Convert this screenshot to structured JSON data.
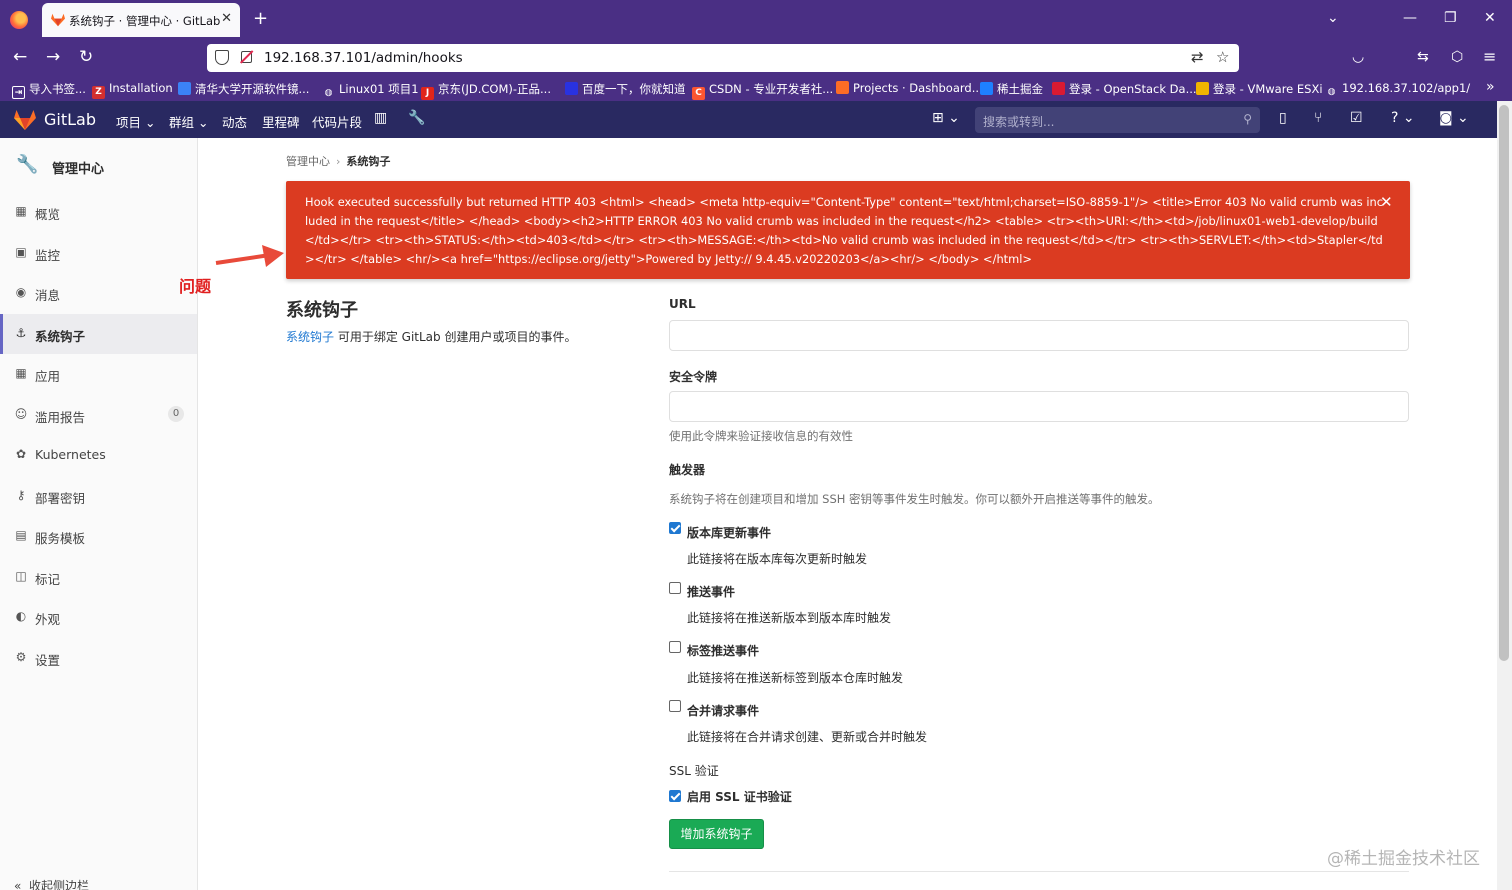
{
  "browser": {
    "tab_title": "系统钩子 · 管理中心 · GitLab",
    "url": "192.168.37.101/admin/hooks",
    "bookmarks": [
      {
        "label": "导入书签...",
        "color": "#4a2f84"
      },
      {
        "label": "Installation",
        "color": "#d32f2f"
      },
      {
        "label": "清华大学开源软件镜...",
        "color": "#3b82f6"
      },
      {
        "label": "Linux01 项目1",
        "color": "#4a2f84"
      },
      {
        "label": "京东(JD.COM)-正品...",
        "color": "#e1251b"
      },
      {
        "label": "百度一下，你就知道",
        "color": "#2932e1"
      },
      {
        "label": "CSDN - 专业开发者社...",
        "color": "#fc5531"
      },
      {
        "label": "Projects · Dashboard...",
        "color": "#fc6d26"
      },
      {
        "label": "稀土掘金",
        "color": "#1e80ff"
      },
      {
        "label": "登录 - OpenStack Da...",
        "color": "#da1a32"
      },
      {
        "label": "登录 - VMware ESXi",
        "color": "#f0b400"
      },
      {
        "label": "192.168.37.102/app1/",
        "color": "#4a2f84"
      }
    ]
  },
  "gitlab": {
    "brand": "GitLab",
    "nav": [
      "项目",
      "群组",
      "动态",
      "里程碑",
      "代码片段"
    ],
    "search_placeholder": "搜索或转到..."
  },
  "sidebar": {
    "title": "管理中心",
    "items": [
      {
        "label": "概览",
        "icon": "overview-icon",
        "glyph": "▦"
      },
      {
        "label": "监控",
        "icon": "monitor-icon",
        "glyph": "▣"
      },
      {
        "label": "消息",
        "icon": "broadcast-icon",
        "glyph": "◉"
      },
      {
        "label": "系统钩子",
        "icon": "hook-icon",
        "glyph": "⚓",
        "active": true
      },
      {
        "label": "应用",
        "icon": "applications-icon",
        "glyph": "▦"
      },
      {
        "label": "滥用报告",
        "icon": "abuse-icon",
        "glyph": "☺",
        "badge": "0"
      },
      {
        "label": "Kubernetes",
        "icon": "kubernetes-icon",
        "glyph": "✿"
      },
      {
        "label": "部署密钥",
        "icon": "key-icon",
        "glyph": "⚷"
      },
      {
        "label": "服务模板",
        "icon": "template-icon",
        "glyph": "▤"
      },
      {
        "label": "标记",
        "icon": "labels-icon",
        "glyph": "◫"
      },
      {
        "label": "外观",
        "icon": "appearance-icon",
        "glyph": "◐"
      },
      {
        "label": "设置",
        "icon": "settings-icon",
        "glyph": "⚙"
      }
    ],
    "collapse_label": "收起侧边栏"
  },
  "breadcrumb": {
    "parent": "管理中心",
    "current": "系统钩子"
  },
  "alert": {
    "message": "Hook executed successfully but returned HTTP 403 <html> <head> <meta http-equiv=\"Content-Type\" content=\"text/html;charset=ISO-8859-1\"/> <title>Error 403 No valid crumb was included in the request</title> </head> <body><h2>HTTP ERROR 403 No valid crumb was included in the request</h2> <table> <tr><th>URI:</th><td>/job/linux01-web1-develop/build</td></tr> <tr><th>STATUS:</th><td>403</td></tr> <tr><th>MESSAGE:</th><td>No valid crumb was included in the request</td></tr> <tr><th>SERVLET:</th><td>Stapler</td></tr> </table> <hr/><a href=\"https://eclipse.org/jetty\">Powered by Jetty:// 9.4.45.v20220203</a><hr/> </body> </html>"
  },
  "annotation": {
    "label": "问题"
  },
  "section": {
    "title": "系统钩子",
    "desc_link": "系统钩子",
    "desc_rest": " 可用于绑定 GitLab 创建用户或项目的事件。"
  },
  "form": {
    "url_label": "URL",
    "url_value": "",
    "token_label": "安全令牌",
    "token_value": "",
    "token_help": "使用此令牌来验证接收信息的有效性",
    "triggers_label": "触发器",
    "triggers_help": "系统钩子将在创建项目和增加 SSH 密钥等事件发生时触发。你可以额外开启推送等事件的触发。",
    "triggers": [
      {
        "label": "版本库更新事件",
        "help": "此链接将在版本库每次更新时触发",
        "checked": true
      },
      {
        "label": "推送事件",
        "help": "此链接将在推送新版本到版本库时触发",
        "checked": false
      },
      {
        "label": "标签推送事件",
        "help": "此链接将在推送新标签到版本仓库时触发",
        "checked": false
      },
      {
        "label": "合并请求事件",
        "help": "此链接将在合并请求创建、更新或合并时触发",
        "checked": false
      }
    ],
    "ssl_label": "SSL 验证",
    "ssl_checkbox": "启用 SSL 证书验证",
    "ssl_checked": true,
    "submit_label": "增加系统钩子"
  },
  "watermark": "@稀土掘金技术社区",
  "colors": {
    "browser_chrome": "#4a2f84",
    "gitlab_header": "#292961",
    "alert_bg": "#db3b21",
    "link": "#1f78d1",
    "submit_bg": "#1aaa55"
  }
}
